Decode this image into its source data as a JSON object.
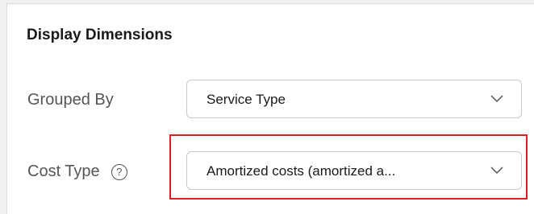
{
  "panel": {
    "title": "Display Dimensions"
  },
  "grouped_by": {
    "label": "Grouped By",
    "value": "Service Type",
    "icon": "chevron-down-icon"
  },
  "cost_type": {
    "label": "Cost Type",
    "help_glyph": "?",
    "value": "Amortized costs (amortized a...",
    "icon": "chevron-down-icon"
  },
  "colors": {
    "highlight": "#e02020",
    "label_text": "#555555",
    "border": "#c8c8c8"
  }
}
